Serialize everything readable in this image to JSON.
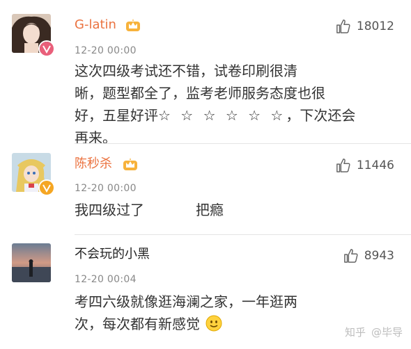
{
  "comments": [
    {
      "username": "G-latin",
      "time": "12-20 00:00",
      "likes": "18012",
      "text_line1": "这次四级考试还不错，试卷印刷很清",
      "text_line2": "晰，题型都全了，监考老师服务态度也很",
      "text_line3a": "好，五星好评",
      "stars": "☆ ☆ ☆ ☆ ☆ ☆",
      "text_line3b": "，下次还会",
      "text_line4": "再来。"
    },
    {
      "username": "陈秒杀",
      "time": "12-20 00:00",
      "likes": "11446",
      "text_a": "我四级过了",
      "text_b": "把瘾"
    },
    {
      "username": "不会玩的小黑",
      "time": "12-20 00:04",
      "likes": "8943",
      "text_line1": "考四六级就像逛海澜之家，一年逛两",
      "text_line2": "次，每次都有新感觉"
    }
  ],
  "watermark": {
    "site": "知乎",
    "author": "@毕导"
  },
  "colors": {
    "username_orange": "#eb7340",
    "time_gray": "#888888",
    "text": "#333333",
    "badge_pink": "#e95f7a",
    "badge_gold": "#f5a623"
  },
  "icons": [
    "thumbs-up-icon",
    "crown-badge-icon",
    "verified-v-icon",
    "smiley-emoji-icon"
  ]
}
